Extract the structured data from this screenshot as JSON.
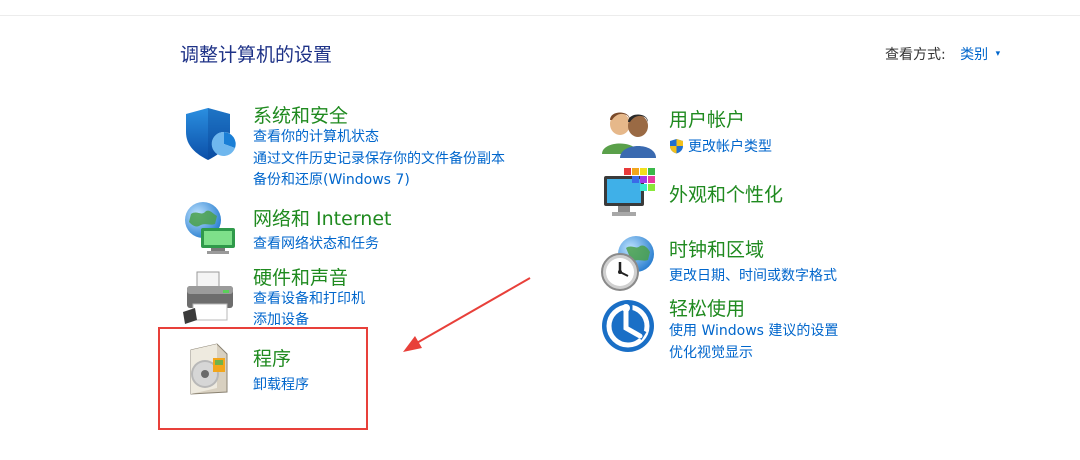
{
  "page": {
    "title": "调整计算机的设置",
    "view_mode_label": "查看方式:",
    "view_mode_value": "类别",
    "view_mode_caret": "▾"
  },
  "categories": {
    "system_security": {
      "title": "系统和安全",
      "links": [
        "查看你的计算机状态",
        "通过文件历史记录保存你的文件备份副本",
        "备份和还原(Windows 7)"
      ],
      "icon": "shield-icon"
    },
    "network": {
      "title": "网络和 Internet",
      "links": [
        "查看网络状态和任务"
      ],
      "icon": "network-globe-icon"
    },
    "hardware_sound": {
      "title": "硬件和声音",
      "links": [
        "查看设备和打印机",
        "添加设备"
      ],
      "icon": "printer-icon"
    },
    "programs": {
      "title": "程序",
      "links": [
        "卸载程序"
      ],
      "icon": "program-disc-icon"
    },
    "user_accounts": {
      "title": "用户帐户",
      "links": [
        "更改帐户类型"
      ],
      "icon": "users-icon"
    },
    "appearance": {
      "title": "外观和个性化",
      "links": [],
      "icon": "monitor-palette-icon"
    },
    "clock_region": {
      "title": "时钟和区域",
      "links": [
        "更改日期、时间或数字格式"
      ],
      "icon": "clock-globe-icon"
    },
    "ease_access": {
      "title": "轻松使用",
      "links": [
        "使用 Windows 建议的设置",
        "优化视觉显示"
      ],
      "icon": "ease-of-access-icon"
    }
  },
  "colors": {
    "title_blue": "#1e3287",
    "category_green": "#1f8a1f",
    "link_blue": "#0066cc",
    "annotation_red": "#e8403a"
  }
}
